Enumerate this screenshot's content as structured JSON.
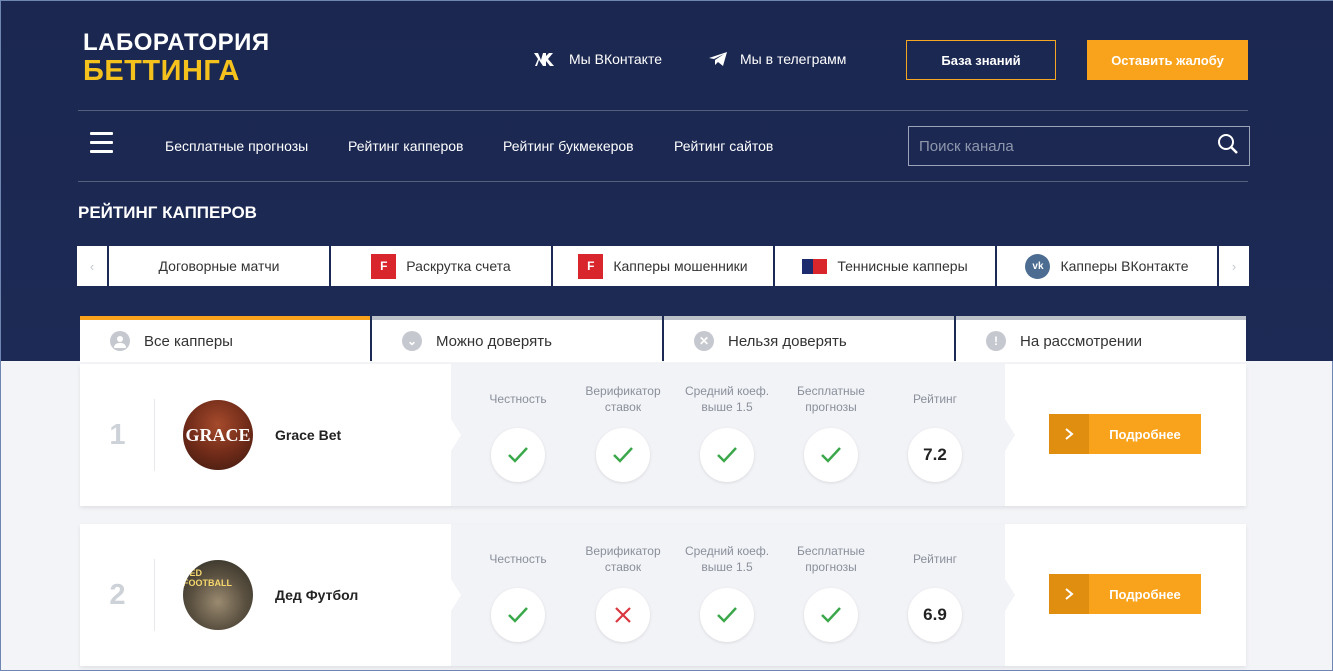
{
  "header": {
    "logo_line1": "LАБОРАТОРИЯ",
    "logo_line2": "БЕТТИНГА",
    "vk_link": "Мы ВКонтакте",
    "telegram_link": "Мы в телеграмм",
    "knowledge_button": "База знаний",
    "complaint_button": "Оставить жалобу"
  },
  "nav": {
    "items": [
      "Бесплатные прогнозы",
      "Рейтинг капперов",
      "Рейтинг букмекеров",
      "Рейтинг сайтов"
    ],
    "search_placeholder": "Поиск канала"
  },
  "section_title": "РЕЙТИНГ КАППЕРОВ",
  "categories": {
    "prev_arrow": "‹",
    "next_arrow": "›",
    "items": [
      {
        "label": "Договорные матчи",
        "icon": "none"
      },
      {
        "label": "Раскрутка счета",
        "icon": "red-f-icon"
      },
      {
        "label": "Капперы мошенники",
        "icon": "red-f-icon"
      },
      {
        "label": "Теннисные капперы",
        "icon": "tennis-flag-icon"
      },
      {
        "label": "Капперы ВКонтакте",
        "icon": "vk-icon"
      }
    ]
  },
  "tabs": [
    {
      "label": "Все капперы",
      "icon": "user-icon",
      "active": true
    },
    {
      "label": "Можно доверять",
      "icon": "chevron-down-icon",
      "active": false
    },
    {
      "label": "Нельзя доверять",
      "icon": "close-icon",
      "active": false
    },
    {
      "label": "На рассмотрении",
      "icon": "exclamation-icon",
      "active": false
    }
  ],
  "metric_labels": {
    "honesty": "Честность",
    "verifier": "Верификатор ставок",
    "avg_coef": "Средний коеф. выше 1.5",
    "free": "Бесплатные прогнозы",
    "rating": "Рейтинг"
  },
  "cappers": [
    {
      "rank": "1",
      "name": "Grace Bet",
      "avatar_text": "GRACE",
      "honesty": true,
      "verifier": true,
      "avg_coef": true,
      "free": true,
      "rating": "7.2",
      "button": "Подробнее"
    },
    {
      "rank": "2",
      "name": "Дед Футбол",
      "avatar_text": "DED FOOTBALL",
      "honesty": true,
      "verifier": false,
      "avg_coef": true,
      "free": true,
      "rating": "6.9",
      "button": "Подробнее"
    }
  ],
  "colors": {
    "accent": "#f9a21b",
    "header_bg": "#1b2750",
    "check": "#3aa84a",
    "cross": "#d9363e",
    "logo_yellow": "#f5c11d"
  }
}
